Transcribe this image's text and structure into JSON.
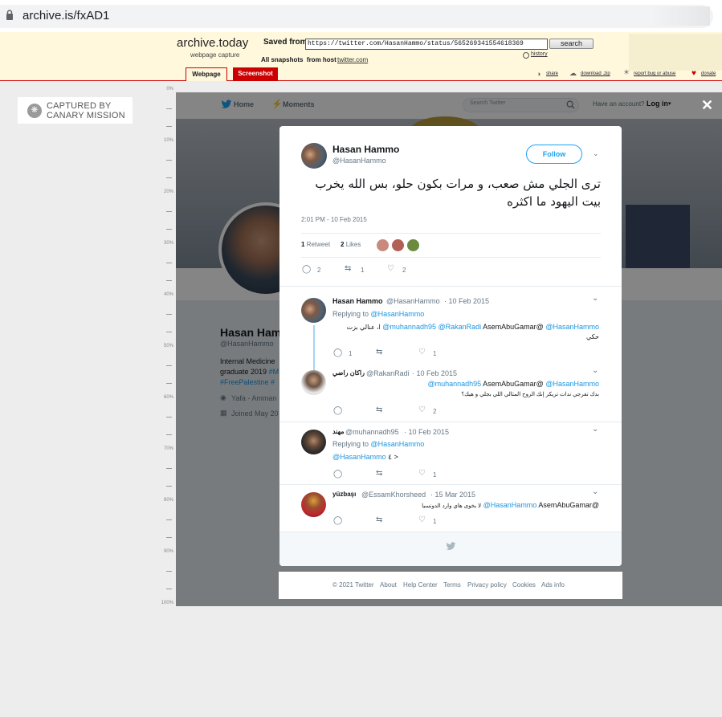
{
  "browser": {
    "url": "archive.is/fxAD1"
  },
  "archive": {
    "logo": "archive.today",
    "logo_sub": "webpage capture",
    "saved_from_label": "Saved from",
    "saved_url": "https://twitter.com/HasanHammo/status/565269341554618369",
    "search_button": "search",
    "history_link": "history",
    "all_snapshots_label": "All snapshots",
    "from_host_label": "from host",
    "host_link": "twitter.com",
    "tab_webpage": "Webpage",
    "tab_screenshot": "Screenshot",
    "share_link": "share",
    "download_link": "download .zip",
    "report_link": "report bug or abuse",
    "donate_link": "donate"
  },
  "canary": {
    "line1": "CAPTURED BY",
    "line2": "CANARY MISSION"
  },
  "ruler": [
    "0%",
    "10%",
    "20%",
    "30%",
    "40%",
    "50%",
    "60%",
    "70%",
    "80%",
    "90%",
    "100%"
  ],
  "twitter_nav": {
    "home": "Home",
    "moments": "Moments",
    "search_placeholder": "Search Twitter",
    "have_account": "Have an account?",
    "login": "Log in"
  },
  "profile_bg": {
    "name": "Hasan Ham",
    "handle": "@HasanHammo",
    "bio1": "Internal Medicine",
    "bio2_prefix": "graduate 2019 ",
    "bio2_link": "#M",
    "bio3": "#FreePalestine #",
    "location": "Yafa - Amman",
    "joined": "Joined May 20"
  },
  "tweet": {
    "name": "Hasan Hammo",
    "handle": "@HasanHammo",
    "follow": "Follow",
    "text_line1": "ترى الجلي مش صعب، و مرات بكون حلو، بس الله يخرب",
    "text_line2": "بيت اليهود ما اكثره",
    "timestamp": "2:01 PM - 10 Feb 2015",
    "retweets_count": "1",
    "retweets_label": "Retweet",
    "likes_count": "2",
    "likes_label": "Likes",
    "reply_count": "2",
    "rt_count": "1",
    "like_count": "2"
  },
  "replies": [
    {
      "name": "Hasan Hammo",
      "handle": "@HasanHammo",
      "date": "· 10 Feb 2015",
      "replying_label": "Replying to",
      "replying_to": "@HasanHammo",
      "mentions": "@muhannadh95 @RakanRadi",
      "mid_text": "AsemAbuGamar@",
      "mention_end": "@HasanHammo",
      "arabic_pre": "ا، عنالي بزت",
      "arabic_line2": "حكي",
      "reply_count": "1",
      "like_count": "1"
    },
    {
      "name": "راكان راضي",
      "handle": "@RakanRadi",
      "date": "· 10 Feb 2015",
      "mention_a": "@muhannadh95",
      "mid_text": "AsemAbuGamar@",
      "mention_b": "@HasanHammo",
      "arabic": "بدك تفرجي ندات تريكر إنك الروح المثالي اللي بجلي و هيك؟",
      "like_count": "2"
    },
    {
      "name": "مهند",
      "handle": "@muhannadh95",
      "date": "· 10 Feb 2015",
      "replying_label": "Replying to",
      "replying_to": "@HasanHammo",
      "mention": "@HasanHammo",
      "tail": "٤ >",
      "like_count": "1"
    },
    {
      "name": "yüzbaşı",
      "handle": "@EssamKhorsheed",
      "date": "· 15 Mar 2015",
      "arabic": "لا بخوى هاي وارد الدونسيا",
      "mention": "@HasanHammo",
      "mid_text": "AsemAbuGamar@",
      "like_count": "1"
    }
  ],
  "footer": {
    "copyright": "© 2021 Twitter",
    "about": "About",
    "help": "Help Center",
    "terms": "Terms",
    "privacy": "Privacy policy",
    "cookies": "Cookies",
    "ads": "Ads info"
  },
  "colors": {
    "twitter_blue": "#1b95e0",
    "archive_red": "#cc0000",
    "archive_bg": "#fff8dc"
  }
}
